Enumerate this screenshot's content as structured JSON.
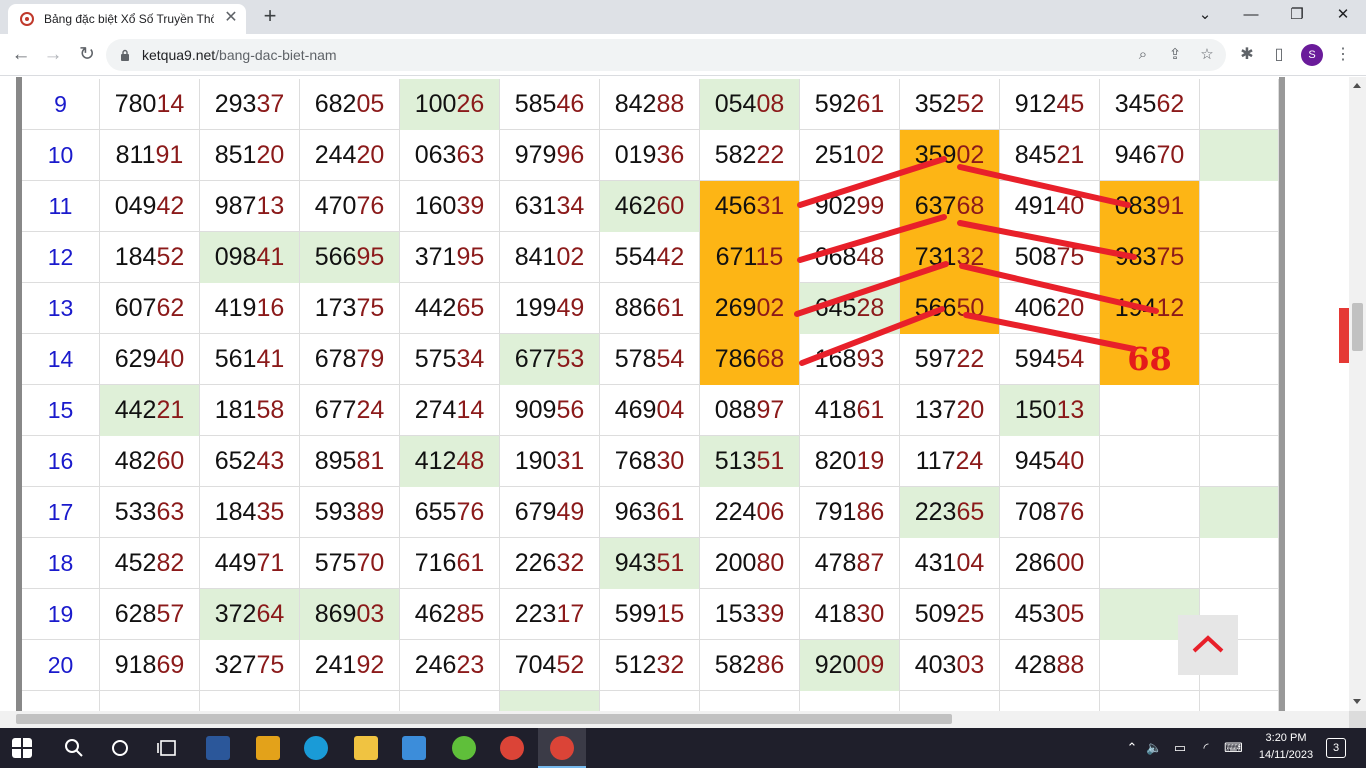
{
  "browser": {
    "tab_title": "Bảng đặc biệt Xổ Số Truyền Thố",
    "url_domain": "ketqua9.net",
    "url_path": "/bang-dac-biet-nam",
    "avatar_letter": "S"
  },
  "table": {
    "rows": [
      {
        "no": "9",
        "cells": [
          [
            "780",
            "14",
            ""
          ],
          [
            "293",
            "37",
            ""
          ],
          [
            "682",
            "05",
            ""
          ],
          [
            "100",
            "26",
            "green"
          ],
          [
            "585",
            "46",
            ""
          ],
          [
            "842",
            "88",
            ""
          ],
          [
            "054",
            "08",
            "green"
          ],
          [
            "592",
            "61",
            ""
          ],
          [
            "352",
            "52",
            ""
          ],
          [
            "912",
            "45",
            ""
          ],
          [
            "345",
            "62",
            ""
          ],
          [
            "",
            "",
            ""
          ]
        ]
      },
      {
        "no": "10",
        "cells": [
          [
            "811",
            "91",
            ""
          ],
          [
            "851",
            "20",
            ""
          ],
          [
            "244",
            "20",
            ""
          ],
          [
            "063",
            "63",
            ""
          ],
          [
            "979",
            "96",
            ""
          ],
          [
            "019",
            "36",
            ""
          ],
          [
            "582",
            "22",
            ""
          ],
          [
            "251",
            "02",
            ""
          ],
          [
            "359",
            "02",
            "orange"
          ],
          [
            "845",
            "21",
            ""
          ],
          [
            "946",
            "70",
            ""
          ],
          [
            "",
            "",
            "green"
          ]
        ]
      },
      {
        "no": "11",
        "cells": [
          [
            "049",
            "42",
            ""
          ],
          [
            "987",
            "13",
            ""
          ],
          [
            "470",
            "76",
            ""
          ],
          [
            "160",
            "39",
            ""
          ],
          [
            "631",
            "34",
            ""
          ],
          [
            "462",
            "60",
            "green"
          ],
          [
            "456",
            "31",
            "orange"
          ],
          [
            "902",
            "99",
            ""
          ],
          [
            "637",
            "68",
            "orange"
          ],
          [
            "491",
            "40",
            ""
          ],
          [
            "083",
            "91",
            "orange"
          ],
          [
            "",
            "",
            ""
          ]
        ]
      },
      {
        "no": "12",
        "cells": [
          [
            "184",
            "52",
            ""
          ],
          [
            "098",
            "41",
            "green"
          ],
          [
            "566",
            "95",
            "green"
          ],
          [
            "371",
            "95",
            ""
          ],
          [
            "841",
            "02",
            ""
          ],
          [
            "554",
            "42",
            ""
          ],
          [
            "671",
            "15",
            "orange"
          ],
          [
            "068",
            "48",
            ""
          ],
          [
            "731",
            "32",
            "orange"
          ],
          [
            "508",
            "75",
            ""
          ],
          [
            "983",
            "75",
            "orange"
          ],
          [
            "",
            "",
            ""
          ]
        ]
      },
      {
        "no": "13",
        "cells": [
          [
            "607",
            "62",
            ""
          ],
          [
            "419",
            "16",
            ""
          ],
          [
            "173",
            "75",
            ""
          ],
          [
            "442",
            "65",
            ""
          ],
          [
            "199",
            "49",
            ""
          ],
          [
            "886",
            "61",
            ""
          ],
          [
            "269",
            "02",
            "orange"
          ],
          [
            "645",
            "28",
            "green"
          ],
          [
            "566",
            "50",
            "orange"
          ],
          [
            "406",
            "20",
            ""
          ],
          [
            "194",
            "12",
            "orange"
          ],
          [
            "",
            "",
            ""
          ]
        ]
      },
      {
        "no": "14",
        "cells": [
          [
            "629",
            "40",
            ""
          ],
          [
            "561",
            "41",
            ""
          ],
          [
            "678",
            "79",
            ""
          ],
          [
            "575",
            "34",
            ""
          ],
          [
            "677",
            "53",
            "green"
          ],
          [
            "578",
            "54",
            ""
          ],
          [
            "786",
            "68",
            "orange"
          ],
          [
            "168",
            "93",
            ""
          ],
          [
            "597",
            "22",
            ""
          ],
          [
            "594",
            "54",
            ""
          ],
          [
            "",
            "68",
            "orange big68"
          ],
          [
            "",
            "",
            ""
          ]
        ]
      },
      {
        "no": "15",
        "cells": [
          [
            "442",
            "21",
            "green"
          ],
          [
            "181",
            "58",
            ""
          ],
          [
            "677",
            "24",
            ""
          ],
          [
            "274",
            "14",
            ""
          ],
          [
            "909",
            "56",
            ""
          ],
          [
            "469",
            "04",
            ""
          ],
          [
            "088",
            "97",
            ""
          ],
          [
            "418",
            "61",
            ""
          ],
          [
            "137",
            "20",
            ""
          ],
          [
            "150",
            "13",
            "green"
          ],
          [
            "",
            "",
            ""
          ],
          [
            "",
            "",
            ""
          ]
        ]
      },
      {
        "no": "16",
        "cells": [
          [
            "482",
            "60",
            ""
          ],
          [
            "652",
            "43",
            ""
          ],
          [
            "895",
            "81",
            ""
          ],
          [
            "412",
            "48",
            "green"
          ],
          [
            "190",
            "31",
            ""
          ],
          [
            "768",
            "30",
            ""
          ],
          [
            "513",
            "51",
            "green"
          ],
          [
            "820",
            "19",
            ""
          ],
          [
            "117",
            "24",
            ""
          ],
          [
            "945",
            "40",
            ""
          ],
          [
            "",
            "",
            ""
          ],
          [
            "",
            "",
            ""
          ]
        ]
      },
      {
        "no": "17",
        "cells": [
          [
            "533",
            "63",
            ""
          ],
          [
            "184",
            "35",
            ""
          ],
          [
            "593",
            "89",
            ""
          ],
          [
            "655",
            "76",
            ""
          ],
          [
            "679",
            "49",
            ""
          ],
          [
            "963",
            "61",
            ""
          ],
          [
            "224",
            "06",
            ""
          ],
          [
            "791",
            "86",
            ""
          ],
          [
            "223",
            "65",
            "green"
          ],
          [
            "708",
            "76",
            ""
          ],
          [
            "",
            "",
            ""
          ],
          [
            "",
            "",
            "green"
          ]
        ]
      },
      {
        "no": "18",
        "cells": [
          [
            "452",
            "82",
            ""
          ],
          [
            "449",
            "71",
            ""
          ],
          [
            "575",
            "70",
            ""
          ],
          [
            "716",
            "61",
            ""
          ],
          [
            "226",
            "32",
            ""
          ],
          [
            "943",
            "51",
            "green"
          ],
          [
            "200",
            "80",
            ""
          ],
          [
            "478",
            "87",
            ""
          ],
          [
            "431",
            "04",
            ""
          ],
          [
            "286",
            "00",
            ""
          ],
          [
            "",
            "",
            ""
          ],
          [
            "",
            "",
            ""
          ]
        ]
      },
      {
        "no": "19",
        "cells": [
          [
            "628",
            "57",
            ""
          ],
          [
            "372",
            "64",
            "green"
          ],
          [
            "869",
            "03",
            "green"
          ],
          [
            "462",
            "85",
            ""
          ],
          [
            "223",
            "17",
            ""
          ],
          [
            "599",
            "15",
            ""
          ],
          [
            "153",
            "39",
            ""
          ],
          [
            "418",
            "30",
            ""
          ],
          [
            "509",
            "25",
            ""
          ],
          [
            "453",
            "05",
            ""
          ],
          [
            "",
            "",
            "green"
          ],
          [
            "",
            "",
            ""
          ]
        ]
      },
      {
        "no": "20",
        "cells": [
          [
            "918",
            "69",
            ""
          ],
          [
            "327",
            "75",
            ""
          ],
          [
            "241",
            "92",
            ""
          ],
          [
            "246",
            "23",
            ""
          ],
          [
            "704",
            "52",
            ""
          ],
          [
            "512",
            "32",
            ""
          ],
          [
            "582",
            "86",
            ""
          ],
          [
            "920",
            "09",
            "green"
          ],
          [
            "403",
            "03",
            ""
          ],
          [
            "428",
            "88",
            ""
          ],
          [
            "",
            "",
            ""
          ],
          [
            "",
            "",
            ""
          ]
        ]
      },
      {
        "no": "",
        "cells": [
          [
            "",
            "",
            ""
          ],
          [
            "",
            "",
            ""
          ],
          [
            "",
            "",
            ""
          ],
          [
            "",
            "",
            ""
          ],
          [
            "",
            "",
            "green"
          ],
          [
            "",
            "",
            ""
          ],
          [
            "",
            "",
            ""
          ],
          [
            "",
            "",
            ""
          ],
          [
            "",
            "",
            ""
          ],
          [
            "",
            "",
            ""
          ],
          [
            "",
            "",
            ""
          ],
          [
            "",
            "",
            ""
          ]
        ]
      }
    ]
  },
  "annotation": {
    "color": "#e8202a"
  },
  "taskbar": {
    "time": "3:20 PM",
    "date": "14/11/2023",
    "notification_count": "3"
  }
}
